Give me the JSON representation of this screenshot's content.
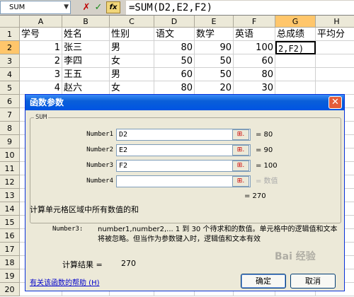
{
  "formula_bar": {
    "name_box": "SUM",
    "fx_label": "fx",
    "cancel_glyph": "✗",
    "enter_glyph": "✓",
    "formula": "=SUM(D2,E2,F2)"
  },
  "sheet": {
    "columns": [
      "A",
      "B",
      "C",
      "D",
      "E",
      "F",
      "G",
      "H"
    ],
    "active_column": "G",
    "active_row": "2",
    "rows": [
      {
        "n": "1",
        "cells": [
          "学号",
          "姓名",
          "性别",
          "语文",
          "数学",
          "英语",
          "总成绩",
          "平均分"
        ]
      },
      {
        "n": "2",
        "cells": [
          "1",
          "张三",
          "男",
          "80",
          "90",
          "100",
          "",
          ""
        ]
      },
      {
        "n": "3",
        "cells": [
          "2",
          "李四",
          "女",
          "50",
          "50",
          "60",
          "",
          ""
        ]
      },
      {
        "n": "4",
        "cells": [
          "3",
          "王五",
          "男",
          "60",
          "50",
          "80",
          "",
          ""
        ]
      },
      {
        "n": "5",
        "cells": [
          "4",
          "赵六",
          "女",
          "80",
          "20",
          "30",
          "",
          ""
        ]
      },
      {
        "n": "6",
        "cells": [
          "",
          "",
          "",
          "",
          "",
          "",
          "",
          ""
        ]
      },
      {
        "n": "7",
        "cells": [
          "",
          "",
          "",
          "",
          "",
          "",
          "",
          ""
        ]
      },
      {
        "n": "8",
        "cells": [
          "",
          "",
          "",
          "",
          "",
          "",
          "",
          ""
        ]
      },
      {
        "n": "9",
        "cells": [
          "",
          "",
          "",
          "",
          "",
          "",
          "",
          ""
        ]
      },
      {
        "n": "10",
        "cells": [
          "",
          "",
          "",
          "",
          "",
          "",
          "",
          ""
        ]
      },
      {
        "n": "11",
        "cells": [
          "",
          "",
          "",
          "",
          "",
          "",
          "",
          ""
        ]
      },
      {
        "n": "12",
        "cells": [
          "",
          "",
          "",
          "",
          "",
          "",
          "",
          ""
        ]
      },
      {
        "n": "13",
        "cells": [
          "",
          "",
          "",
          "",
          "",
          "",
          "",
          ""
        ]
      },
      {
        "n": "14",
        "cells": [
          "",
          "",
          "",
          "",
          "",
          "",
          "",
          ""
        ]
      },
      {
        "n": "15",
        "cells": [
          "",
          "",
          "",
          "",
          "",
          "",
          "",
          ""
        ]
      },
      {
        "n": "16",
        "cells": [
          "",
          "",
          "",
          "",
          "",
          "",
          "",
          ""
        ]
      },
      {
        "n": "17",
        "cells": [
          "",
          "",
          "",
          "",
          "",
          "",
          "",
          ""
        ]
      },
      {
        "n": "18",
        "cells": [
          "",
          "",
          "",
          "",
          "",
          "",
          "",
          ""
        ]
      },
      {
        "n": "19",
        "cells": [
          "",
          "",
          "",
          "",
          "",
          "",
          "",
          ""
        ]
      },
      {
        "n": "20",
        "cells": [
          "",
          "",
          "",
          "",
          "",
          "",
          "",
          ""
        ]
      }
    ],
    "active_cell_text": "2,F2)"
  },
  "dialog": {
    "title": "函数参数",
    "close_glyph": "✕",
    "function_name": "SUM",
    "args": [
      {
        "label": "Number1",
        "value": "D2",
        "result": "= 80"
      },
      {
        "label": "Number2",
        "value": "E2",
        "result": "= 90"
      },
      {
        "label": "Number3",
        "value": "F2",
        "result": "= 100"
      },
      {
        "label": "Number4",
        "value": "",
        "result": "= 数值"
      }
    ],
    "ref_button_glyph": "⊞.",
    "total_result": "= 270",
    "function_description": "计算单元格区域中所有数值的和",
    "arg_desc_name": "Number3:",
    "arg_desc_text": "number1,number2,... 1 到 30 个待求和的数值。单元格中的逻辑值和文本将被忽略。但当作为参数键入时，逻辑值和文本有效",
    "calc_result_label": "计算结果 =",
    "calc_result_value": "270",
    "help_link": "有关该函数的帮助 (H)",
    "ok_label": "确定",
    "cancel_label": "取消"
  },
  "watermark": "Bai 经验"
}
